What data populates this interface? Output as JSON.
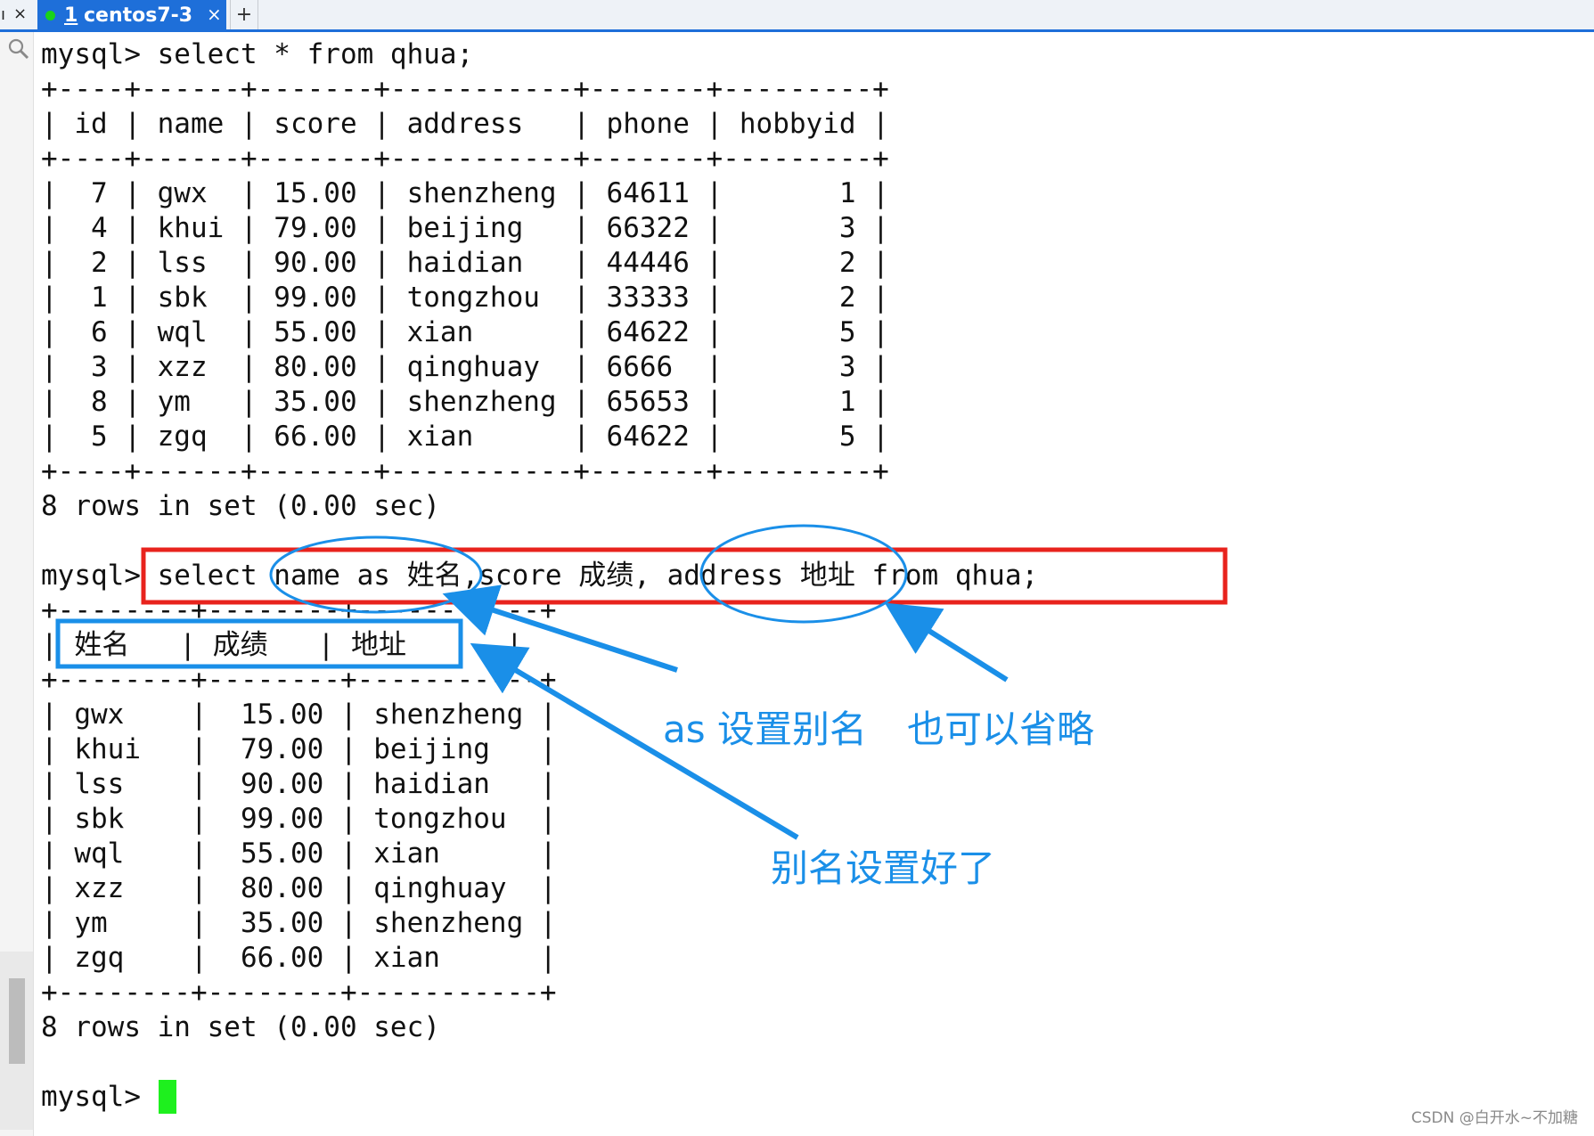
{
  "tabbar": {
    "left_mark": "ı",
    "left_close": "×",
    "tab": {
      "number": "1",
      "title": "centos7-3",
      "close": "×"
    },
    "add": "+"
  },
  "terminal": {
    "lines": [
      "mysql> select * from qhua;",
      "+----+------+-------+-----------+-------+---------+",
      "| id | name | score | address   | phone | hobbyid |",
      "+----+------+-------+-----------+-------+---------+",
      "|  7 | gwx  | 15.00 | shenzheng | 64611 |       1 |",
      "|  4 | khui | 79.00 | beijing   | 66322 |       3 |",
      "|  2 | lss  | 90.00 | haidian   | 44446 |       2 |",
      "|  1 | sbk  | 99.00 | tongzhou  | 33333 |       2 |",
      "|  6 | wql  | 55.00 | xian      | 64622 |       5 |",
      "|  3 | xzz  | 80.00 | qinghuay  | 6666  |       3 |",
      "|  8 | ym   | 35.00 | shenzheng | 65653 |       1 |",
      "|  5 | zgq  | 66.00 | xian      | 64622 |       5 |",
      "+----+------+-------+-----------+-------+---------+",
      "8 rows in set (0.00 sec)",
      "",
      "mysql> select name as 姓名,score 成绩, address 地址 from qhua;",
      "+--------+--------+-----------+",
      "| 姓名   | 成绩   | 地址      |",
      "+--------+--------+-----------+",
      "| gwx    |  15.00 | shenzheng |",
      "| khui   |  79.00 | beijing   |",
      "| lss    |  90.00 | haidian   |",
      "| sbk    |  99.00 | tongzhou  |",
      "| wql    |  55.00 | xian      |",
      "| xzz    |  80.00 | qinghuay  |",
      "| ym     |  35.00 | shenzheng |",
      "| zgq    |  66.00 | xian      |",
      "+--------+--------+-----------+",
      "8 rows in set (0.00 sec)",
      "",
      "mysql> "
    ]
  },
  "annotations": {
    "as_alias": "as 设置别名",
    "can_omit": "也可以省略",
    "alias_done": "别名设置好了",
    "red_color": "#e8231d",
    "blue_color": "#1a8fe8"
  },
  "watermark": "CSDN @白开水~不加糖"
}
